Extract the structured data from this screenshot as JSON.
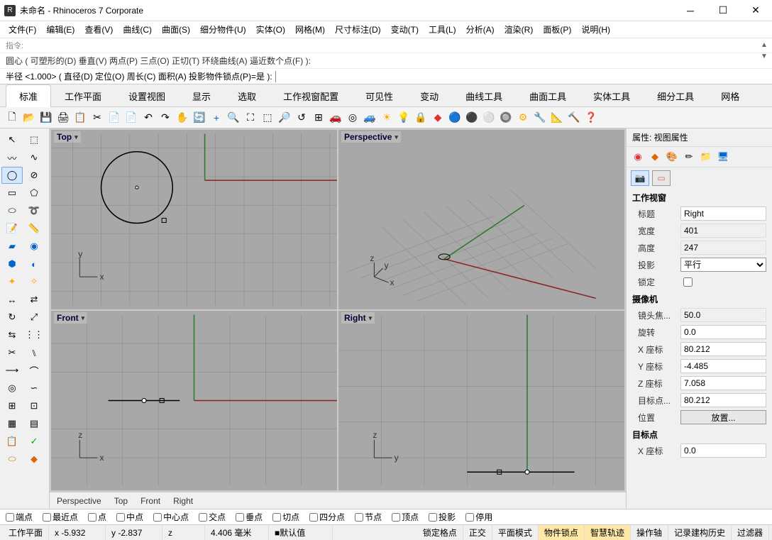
{
  "window": {
    "title": "未命名 - Rhinoceros 7 Corporate"
  },
  "menu": [
    "文件(F)",
    "编辑(E)",
    "查看(V)",
    "曲线(C)",
    "曲面(S)",
    "细分物件(U)",
    "实体(O)",
    "网格(M)",
    "尺寸标注(D)",
    "变动(T)",
    "工具(L)",
    "分析(A)",
    "渲染(R)",
    "面板(P)",
    "说明(H)"
  ],
  "cmd1": "指令:",
  "cmd2": "圆心 ( 可塑形的(D)  垂直(V)  两点(P)  三点(O)  正切(T)  环绕曲线(A)  逼近数个点(F) ):",
  "cmd3_prompt": "半径 <1.000> ( 直径(D)  定位(O)  周长(C)  面积(A)  投影物件锁点(P)=是 ):",
  "tabs": [
    "标准",
    "工作平面",
    "设置视图",
    "显示",
    "选取",
    "工作视窗配置",
    "可见性",
    "变动",
    "曲线工具",
    "曲面工具",
    "实体工具",
    "细分工具",
    "网格"
  ],
  "viewports": {
    "tl": "Top",
    "tr": "Perspective",
    "bl": "Front",
    "br": "Right"
  },
  "vptabs": [
    "Perspective",
    "Top",
    "Front",
    "Right"
  ],
  "panel": {
    "title": "属性: 视图属性",
    "section1": "工作视窗",
    "rows1": {
      "title_lbl": "标题",
      "title_val": "Right",
      "width_lbl": "宽度",
      "width_val": "401",
      "height_lbl": "高度",
      "height_val": "247",
      "proj_lbl": "投影",
      "proj_val": "平行",
      "lock_lbl": "锁定"
    },
    "section2": "摄像机",
    "rows2": {
      "focal_lbl": "镜头焦...",
      "focal_val": "50.0",
      "rot_lbl": "旋转",
      "rot_val": "0.0",
      "x_lbl": "X 座标",
      "x_val": "80.212",
      "y_lbl": "Y 座标",
      "y_val": "-4.485",
      "z_lbl": "Z 座标",
      "z_val": "7.058",
      "tgt_lbl": "目标点...",
      "tgt_val": "80.212",
      "pos_lbl": "位置",
      "pos_btn": "放置..."
    },
    "section3": "目标点",
    "rows3": {
      "x_lbl": "X 座标",
      "x_val": "0.0"
    }
  },
  "osnap": [
    "端点",
    "最近点",
    "点",
    "中点",
    "中心点",
    "交点",
    "垂点",
    "切点",
    "四分点",
    "节点",
    "顶点",
    "投影",
    "停用"
  ],
  "status": {
    "plane": "工作平面",
    "x": "x -5.932",
    "y": "y -2.837",
    "z": "z",
    "dist": "4.406 毫米",
    "def": "默认值",
    "items": [
      "锁定格点",
      "正交",
      "平面模式",
      "物件锁点",
      "智慧轨迹",
      "操作轴",
      "记录建构历史",
      "过滤器"
    ]
  }
}
